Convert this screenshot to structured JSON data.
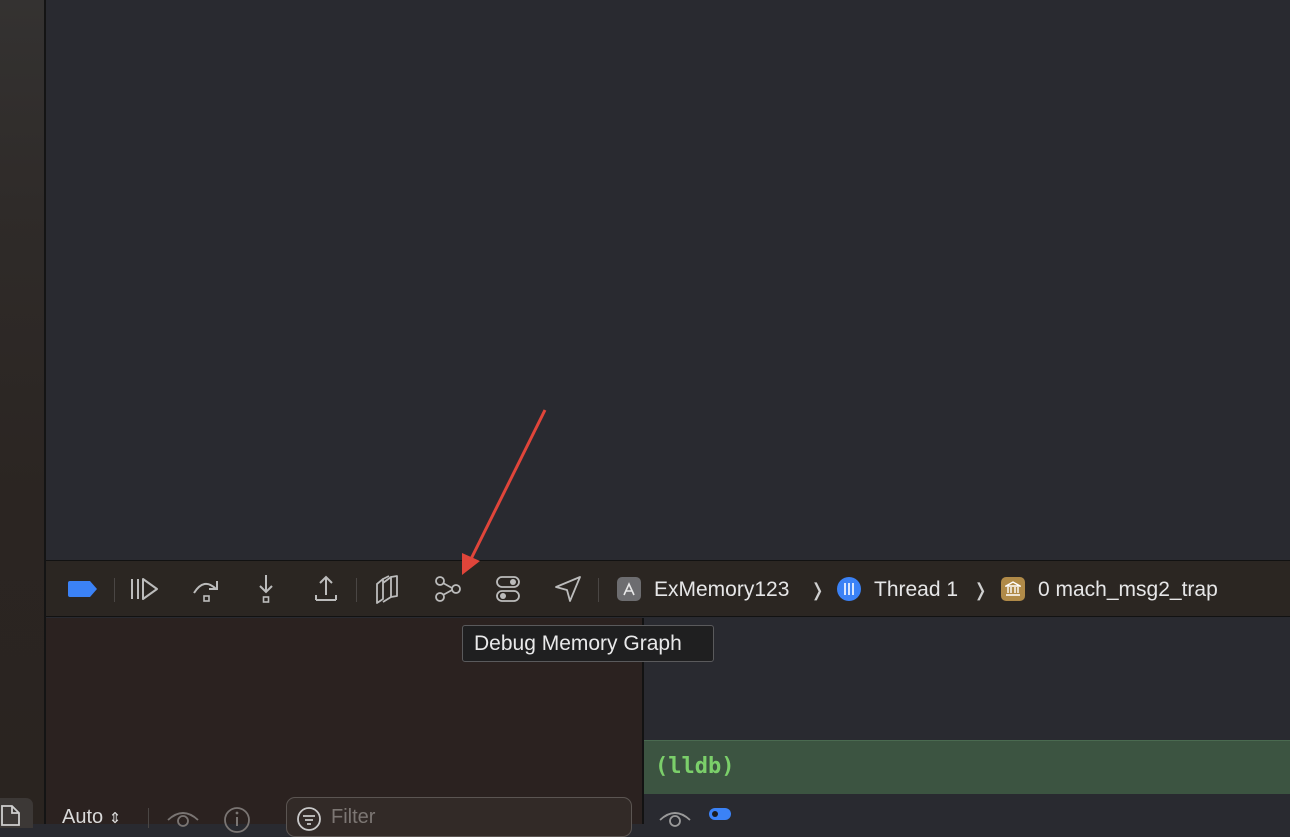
{
  "debug_toolbar": {
    "breadcrumbs": [
      {
        "label": "ExMemory123",
        "icon": "app-store-icon"
      },
      {
        "label": "Thread 1",
        "icon": "thread-icon"
      },
      {
        "label": "0 mach_msg2_trap",
        "icon": "bank-building-icon"
      }
    ],
    "buttons": [
      "toggle-breakpoints-icon",
      "continue-icon",
      "step-over-icon",
      "step-into-icon",
      "step-out-icon",
      "debug-view-hierarchy-icon",
      "debug-memory-graph-icon",
      "environment-overrides-icon",
      "simulate-location-icon"
    ]
  },
  "tooltip": {
    "text": "Debug Memory Graph"
  },
  "console": {
    "prompt": "(lldb)"
  },
  "variables_panel": {
    "scope_select": "Auto",
    "filter_placeholder": "Filter"
  },
  "colors": {
    "accent_blue": "#3b82f6",
    "lldb_green": "#7bcf6a",
    "annotation_arrow": "#e0453a"
  }
}
